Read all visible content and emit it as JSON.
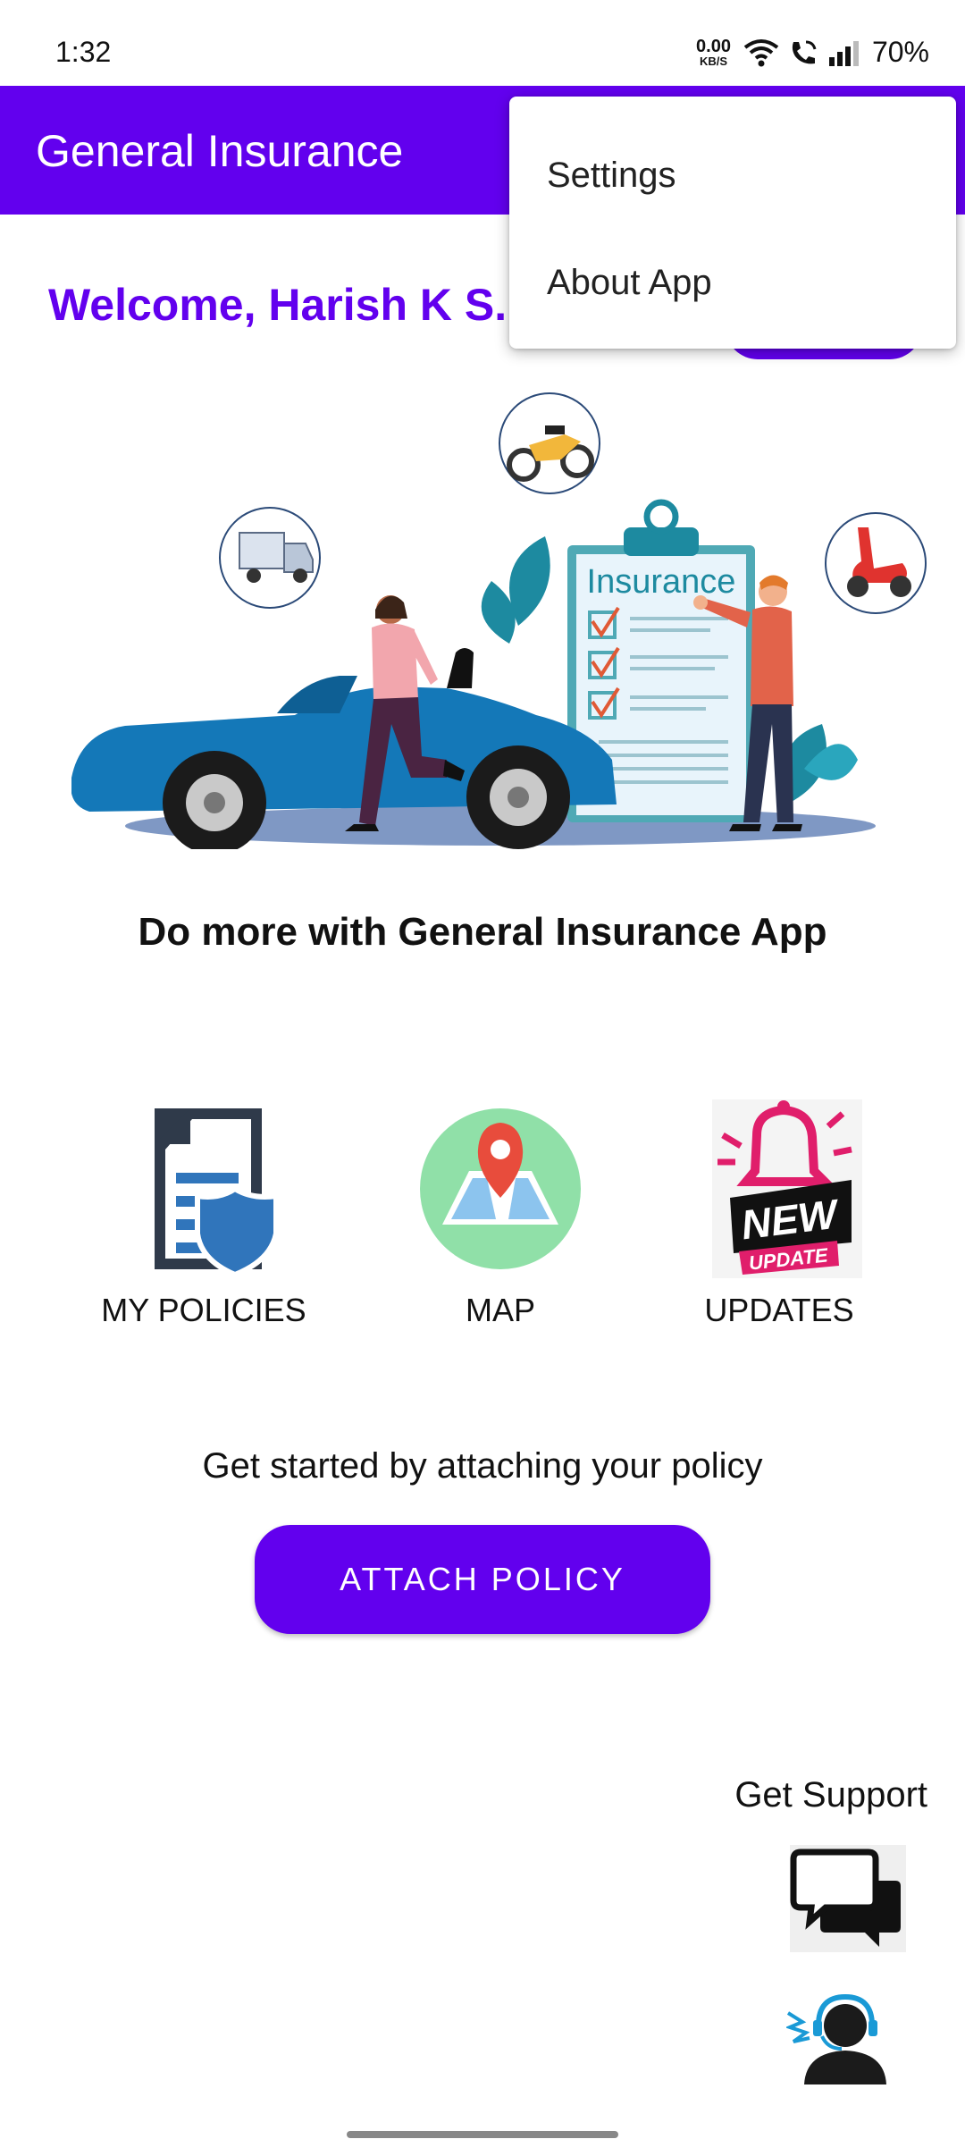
{
  "status_bar": {
    "time": "1:32",
    "net_speed_value": "0.00",
    "net_speed_unit": "KB/S",
    "battery": "70%"
  },
  "app_bar": {
    "title": "General Insurance"
  },
  "welcome": {
    "text": "Welcome, Harish K S."
  },
  "menu": {
    "items": [
      {
        "label": "Settings"
      },
      {
        "label": "About App"
      }
    ]
  },
  "hero": {
    "clipboard_text": "Insurance"
  },
  "tagline": "Do more with General Insurance App",
  "tiles": [
    {
      "label": "MY POLICIES",
      "icon": "policy-document-icon"
    },
    {
      "label": "MAP",
      "icon": "map-pin-icon"
    },
    {
      "label": "UPDATES",
      "icon": "new-update-icon",
      "badge_line1": "NEW",
      "badge_line2": "UPDATE"
    }
  ],
  "get_started": {
    "text": "Get started by attaching your policy",
    "button_label": "ATTACH POLICY"
  },
  "support": {
    "label": "Get Support"
  },
  "colors": {
    "primary": "#6200ee",
    "background": "#ffffff"
  }
}
